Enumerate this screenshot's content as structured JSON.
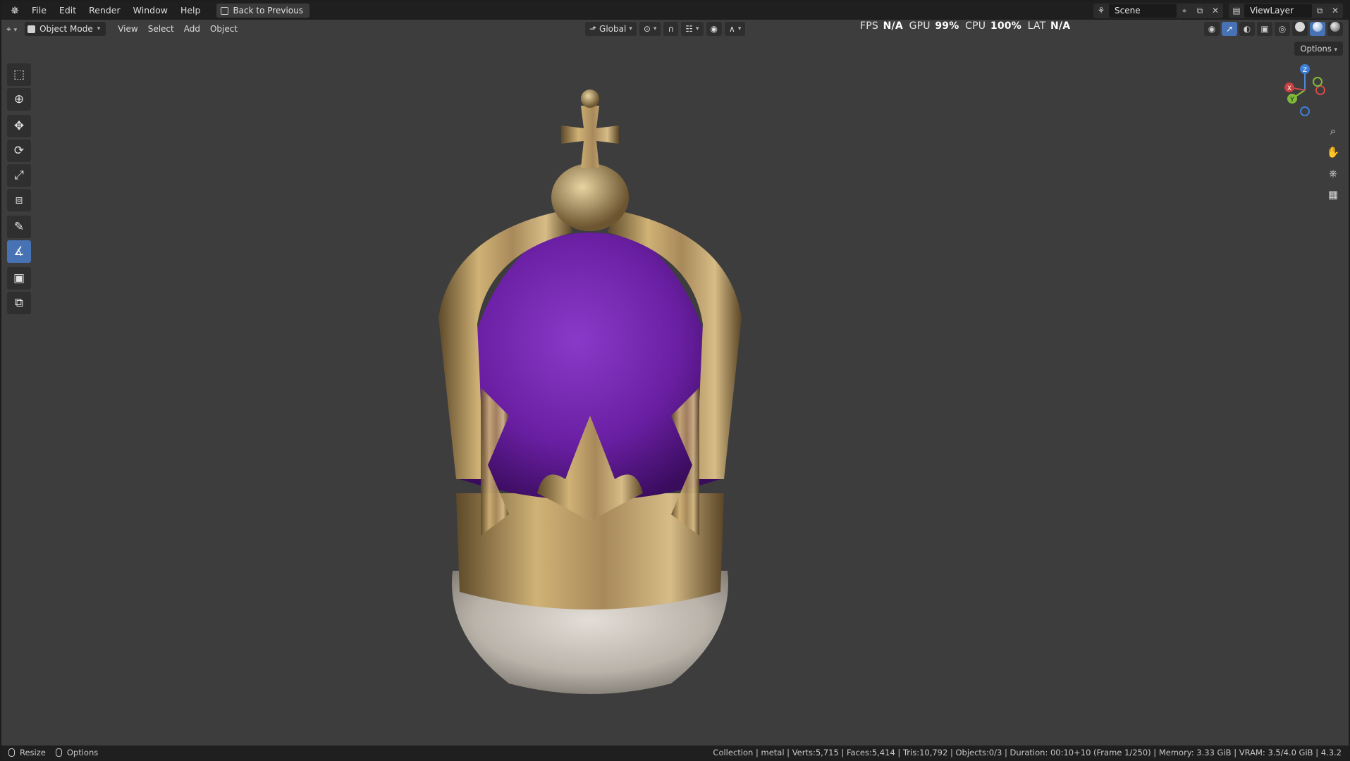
{
  "menu": {
    "items": [
      "File",
      "Edit",
      "Render",
      "Window",
      "Help"
    ],
    "back_button": "Back to Previous"
  },
  "top_right": {
    "scene": "Scene",
    "view_layer": "ViewLayer"
  },
  "header": {
    "mode": "Object Mode",
    "menus": [
      "View",
      "Select",
      "Add",
      "Object"
    ],
    "orientation": "Global",
    "options": "Options"
  },
  "stats": {
    "fps_label": "FPS",
    "fps_value": "N/A",
    "gpu_label": "GPU",
    "gpu_value": "99%",
    "cpu_label": "CPU",
    "cpu_value": "100%",
    "lat_label": "LAT",
    "lat_value": "N/A"
  },
  "gizmo": {
    "x": "X",
    "y": "Y",
    "z": "Z"
  },
  "statusbar": {
    "resize": "Resize",
    "options": "Options",
    "info": "Collection | metal | Verts:5,715 | Faces:5,414 | Tris:10,792 | Objects:0/3 | Duration: 00:10+10 (Frame 1/250) | Memory: 3.33 GiB | VRAM: 3.5/4.0 GiB | 4.3.2"
  },
  "colors": {
    "accent": "#4772b3",
    "viewport_bg": "#3d3d3d",
    "gold": "#b8985a",
    "velvet": "#6a1fa3",
    "fur": "#c9c4bc"
  },
  "icons": [
    "blender-logo",
    "select-box-icon",
    "cursor-icon",
    "move-icon",
    "rotate-icon",
    "scale-icon",
    "transform-icon",
    "annotate-icon",
    "measure-icon",
    "add-cube-icon",
    "extrude-icon",
    "zoom-icon",
    "hand-icon",
    "camera-icon",
    "grid-icon"
  ]
}
